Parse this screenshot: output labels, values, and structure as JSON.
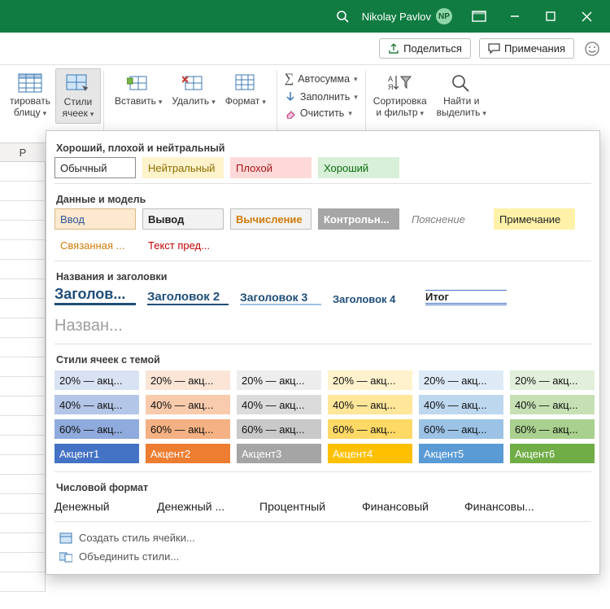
{
  "titlebar": {
    "user_name": "Nikolay Pavlov",
    "avatar_initials": "NP"
  },
  "topbar": {
    "share": "Поделиться",
    "comments": "Примечания"
  },
  "ribbon": {
    "format_table": "тировать\nблицу",
    "cell_styles": "Стили\nячеек",
    "insert": "Вставить",
    "delete": "Удалить",
    "format": "Формат",
    "autosum": "Автосумма",
    "fill": "Заполнить",
    "clear": "Очистить",
    "sort_filter": "Сортировка\nи фильтр",
    "find_select": "Найти и\nвыделить"
  },
  "column_header": "P",
  "sections": {
    "gbn_title": "Хороший, плохой и нейтральный",
    "gbn": {
      "normal": "Обычный",
      "neutral": "Нейтральный",
      "bad": "Плохой",
      "good": "Хороший"
    },
    "data_title": "Данные и модель",
    "data": {
      "input": "Ввод",
      "output": "Вывод",
      "calc": "Вычисление",
      "check": "Контрольн...",
      "explain": "Пояснение",
      "note": "Примечание",
      "linked": "Связанная ...",
      "warn": "Текст пред..."
    },
    "head_title": "Названия и заголовки",
    "head": {
      "h1": "Заголов...",
      "h2": "Заголовок 2",
      "h3": "Заголовок 3",
      "h4": "Заголовок 4",
      "total": "Итог",
      "title": "Назван..."
    },
    "theme_title": "Стили ячеек с темой",
    "theme_rows": [
      [
        {
          "label": "20% — акц...",
          "bg": "#d9e2f3"
        },
        {
          "label": "20% — акц...",
          "bg": "#fbe5d6"
        },
        {
          "label": "20% — акц...",
          "bg": "#ededed"
        },
        {
          "label": "20% — акц...",
          "bg": "#fff2cc"
        },
        {
          "label": "20% — акц...",
          "bg": "#deebf7"
        },
        {
          "label": "20% — акц...",
          "bg": "#e2efda"
        }
      ],
      [
        {
          "label": "40% — акц...",
          "bg": "#b4c6e7"
        },
        {
          "label": "40% — акц...",
          "bg": "#f8cbad"
        },
        {
          "label": "40% — акц...",
          "bg": "#dbdbdb"
        },
        {
          "label": "40% — акц...",
          "bg": "#ffe699"
        },
        {
          "label": "40% — акц...",
          "bg": "#bdd7ee"
        },
        {
          "label": "40% — акц...",
          "bg": "#c6e0b4"
        }
      ],
      [
        {
          "label": "60% — акц...",
          "bg": "#8faadc",
          "tc": 0
        },
        {
          "label": "60% — акц...",
          "bg": "#f4b183",
          "tc": 0
        },
        {
          "label": "60% — акц...",
          "bg": "#c9c9c9",
          "tc": 0
        },
        {
          "label": "60% — акц...",
          "bg": "#ffd966",
          "tc": 0
        },
        {
          "label": "60% — акц...",
          "bg": "#9cc2e5",
          "tc": 0
        },
        {
          "label": "60% — акц...",
          "bg": "#a9d08e",
          "tc": 0
        }
      ],
      [
        {
          "label": "Акцент1",
          "bg": "#4472c4",
          "tc": 1
        },
        {
          "label": "Акцент2",
          "bg": "#ed7d31",
          "tc": 1
        },
        {
          "label": "Акцент3",
          "bg": "#a5a5a5",
          "tc": 1
        },
        {
          "label": "Акцент4",
          "bg": "#ffc000",
          "tc": 1
        },
        {
          "label": "Акцент5",
          "bg": "#5b9bd5",
          "tc": 1
        },
        {
          "label": "Акцент6",
          "bg": "#70ad47",
          "tc": 1
        }
      ]
    ],
    "num_title": "Числовой формат",
    "num": [
      "Денежный",
      "Денежный ...",
      "Процентный",
      "Финансовый",
      "Финансовы..."
    ],
    "footer": {
      "create": "Создать стиль ячейки...",
      "merge": "Объединить стили..."
    }
  }
}
